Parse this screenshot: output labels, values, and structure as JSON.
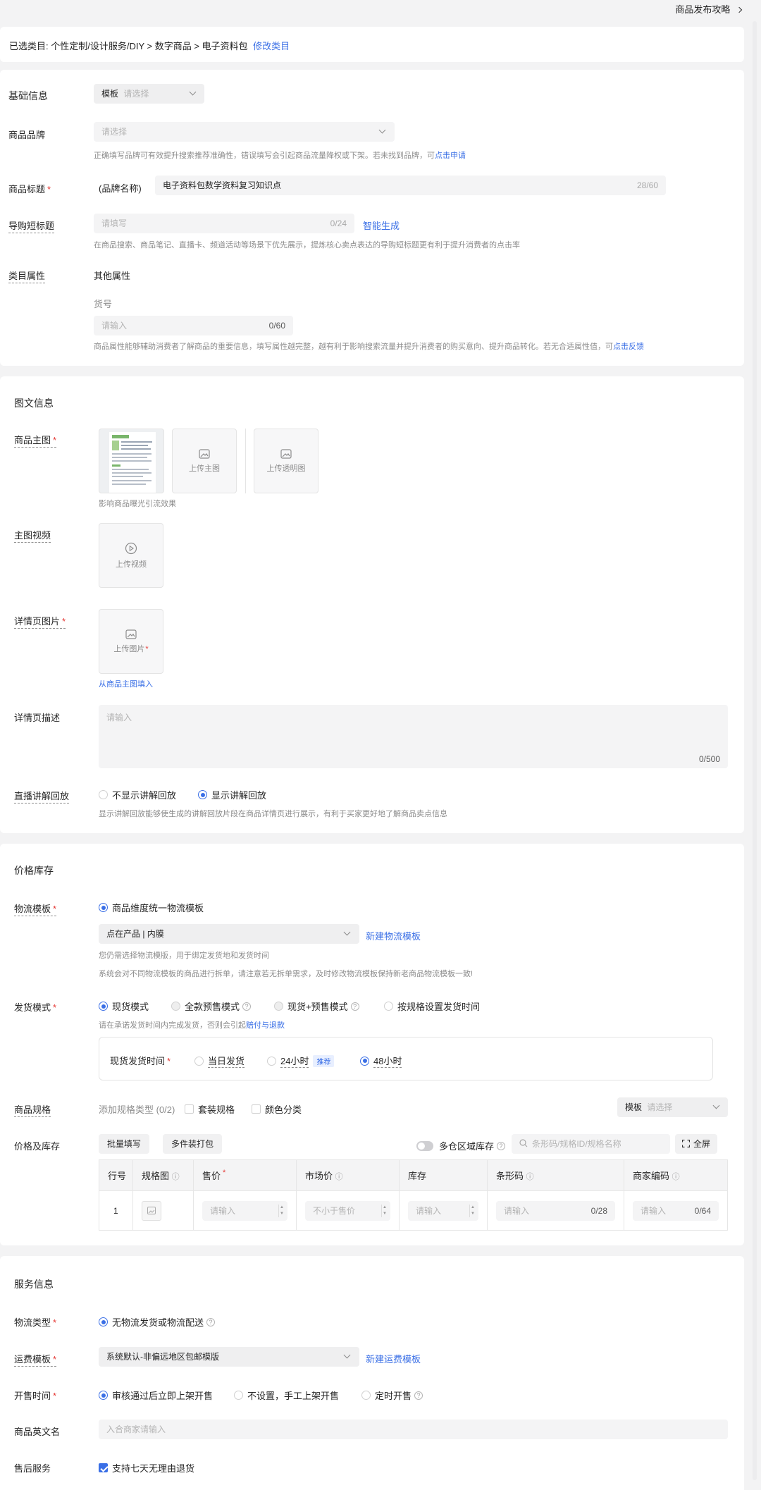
{
  "top": {
    "guide_link": "商品发布攻略"
  },
  "category": {
    "label": "已选类目:",
    "path": "个性定制/设计服务/DIY > 数字商品 > 电子资料包",
    "modify_link": "修改类目"
  },
  "basic": {
    "title": "基础信息",
    "template": {
      "label": "模板",
      "placeholder": "请选择"
    },
    "brand": {
      "label": "商品品牌",
      "placeholder": "请选择",
      "hint": "正确填写品牌可有效提升搜索推荐准确性，错误填写会引起商品流量降权或下架。若未找到品牌，可",
      "hint_link": "点击申请"
    },
    "product_title": {
      "label": "商品标题",
      "prefix": "(品牌名称)",
      "value": "电子资料包数学资料复习知识点",
      "count": "28/60"
    },
    "short_title": {
      "label": "导购短标题",
      "placeholder": "请填写",
      "count": "0/24",
      "ai_link": "智能生成",
      "hint": "在商品搜索、商品笔记、直播卡、频道活动等场景下优先展示，提炼核心卖点表达的导购短标题更有利于提升消费者的点击率"
    },
    "attrs": {
      "label": "类目属性",
      "other": "其他属性",
      "item_no_label": "货号",
      "item_no_placeholder": "请输入",
      "item_no_count": "0/60",
      "hint": "商品属性能够辅助消费者了解商品的重要信息，填写属性越完整，越有利于影响搜索流量并提升消费者的购买意向、提升商品转化。若无合适属性值，可",
      "hint_link": "点击反馈"
    }
  },
  "media": {
    "title": "图文信息",
    "main_image": {
      "label": "商品主图",
      "upload": "上传主图",
      "upload_transparent": "上传透明图",
      "hint": "影响商品曝光引流效果"
    },
    "main_video": {
      "label": "主图视频",
      "upload": "上传视频"
    },
    "detail_images": {
      "label": "详情页图片",
      "upload": "上传图片",
      "fill_link": "从商品主图填入"
    },
    "detail_desc": {
      "label": "详情页描述",
      "placeholder": "请输入",
      "count": "0/500"
    },
    "live_replay": {
      "label": "直播讲解回放",
      "option_off": "不显示讲解回放",
      "option_on": "显示讲解回放",
      "hint": "显示讲解回放能够使生成的讲解回放片段在商品详情页进行展示，有利于买家更好地了解商品卖点信息"
    }
  },
  "price": {
    "title": "价格库存",
    "logistics": {
      "label": "物流模板",
      "option": "商品维度统一物流模板",
      "value": "点在产品 | 内膜",
      "new_link": "新建物流模板",
      "hint1": "您仍需选择物流模版，用于绑定发货地和发货时间",
      "hint2": "系统会对不同物流模板的商品进行拆单，请注意若无拆单需求，及时修改物流模板保持新老商品物流模板一致!"
    },
    "ship_mode": {
      "label": "发货模式",
      "options": [
        "现货模式",
        "全款预售模式",
        "现货+预售模式",
        "按规格设置发货时间"
      ],
      "hint": "请在承诺发货时间内完成发货，否则会引起",
      "hint_link": "赔付与退款",
      "time_label": "现货发货时间",
      "time_options": [
        "当日发货",
        "24小时",
        "48小时"
      ],
      "recommend_badge": "推荐"
    },
    "spec": {
      "label": "商品规格",
      "add_type": "添加规格类型 (0/2)",
      "check_set": "套装规格",
      "check_color": "颜色分类",
      "template_label": "模板",
      "template_placeholder": "请选择"
    },
    "stock": {
      "label": "价格及库存",
      "batch_btn": "批量填写",
      "bundle_btn": "多件装打包",
      "multi_region": "多仓区域库存",
      "search_placeholder": "条形码/规格ID/规格名称",
      "fullscreen": "全屏"
    },
    "table": {
      "headers": [
        "行号",
        "规格图",
        "售价",
        "市场价",
        "库存",
        "条形码",
        "商家编码"
      ],
      "row": {
        "no": "1",
        "price_placeholder": "请输入",
        "market_placeholder": "不小于售价",
        "stock_placeholder": "请输入",
        "barcode_placeholder": "请输入",
        "barcode_count": "0/28",
        "code_placeholder": "请输入",
        "code_count": "0/64"
      }
    }
  },
  "service": {
    "title": "服务信息",
    "logistics_type": {
      "label": "物流类型",
      "option": "无物流发货或物流配送"
    },
    "freight": {
      "label": "运费模板",
      "value": "系统默认-非偏远地区包邮模版",
      "new_link": "新建运费模板"
    },
    "sale_time": {
      "label": "开售时间",
      "options": [
        "审核通过后立即上架开售",
        "不设置，手工上架开售",
        "定时开售"
      ]
    },
    "english_name": {
      "label": "商品英文名",
      "placeholder": "入合商家请输入"
    },
    "after_sale": {
      "label": "售后服务",
      "option": "支持七天无理由退货"
    }
  },
  "colors": {
    "accent": "#3a6fe6",
    "required": "#e53935",
    "background": "#f3f3f4"
  }
}
